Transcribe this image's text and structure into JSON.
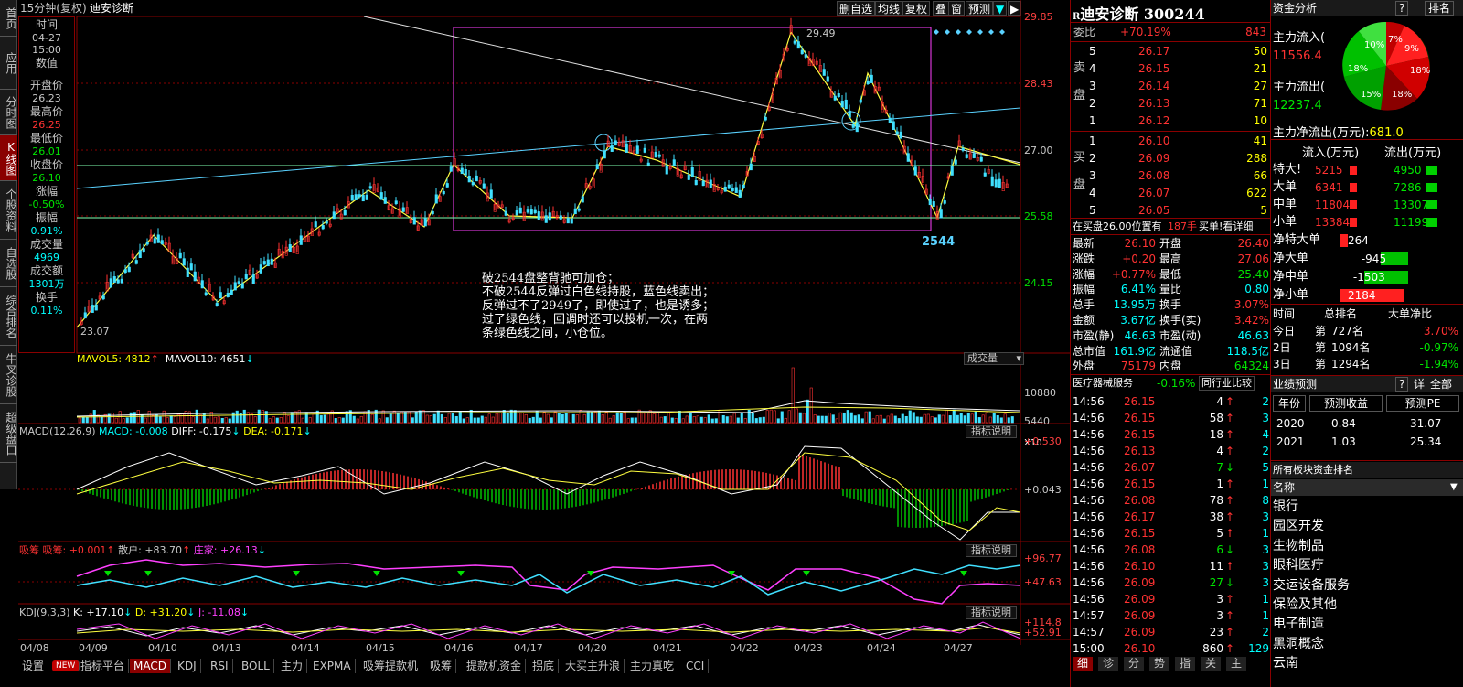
{
  "sidebar": {
    "tabs": [
      "首页",
      "应用",
      "分时图",
      "K线图",
      "个股资料",
      "自选股",
      "综合排名",
      "牛叉诊股",
      "超级盘口"
    ],
    "active": 3
  },
  "chart_header": {
    "period": "15分钟(复权)",
    "name": "迪安诊断",
    "buttons": [
      "删自选",
      "均线",
      "复权",
      "叠",
      "窗",
      "预测"
    ],
    "arrow_icons": [
      "down-arrow-icon",
      "right-arrow-icon"
    ]
  },
  "info": {
    "time_label": "时间",
    "time_date": "04-27",
    "time_clock": "15:00",
    "value_label": "数值",
    "open_label": "开盘价",
    "open": "26.23",
    "high_label": "最高价",
    "high": "26.25",
    "low_label": "最低价",
    "low": "26.01",
    "close_label": "收盘价",
    "close": "26.10",
    "chg_label": "涨幅",
    "chg": "-0.50%",
    "amp_label": "振幅",
    "amp": "0.91%",
    "vol_label": "成交量",
    "vol": "4969",
    "amt_label": "成交额",
    "amt": "1301万",
    "turn_label": "换手",
    "turn": "0.11%"
  },
  "main_chart": {
    "y_labels": [
      "29.85",
      "28.43",
      "27.00",
      "25.58",
      "24.15"
    ],
    "peak_label": "29.49",
    "low_label": "23.07",
    "box_label": "2544",
    "annotation": [
      "破2544盘整背驰可加仓；",
      "不破2544反弹过白色线持股，蓝色线卖出；",
      "反弹过不了2949了，即使过了，也是诱多；",
      "过了绿色线，回调时还可以投机一次，在两",
      "条绿色线之间，小仓位。"
    ]
  },
  "volume_panel": {
    "mavol5_label": "MAVOL5: ",
    "mavol5": "4812",
    "mavol10_label": "MAVOL10: ",
    "mavol10": "4651",
    "selector": "成交量",
    "y_labels": [
      "10880",
      "5440",
      "X10"
    ]
  },
  "macd_panel": {
    "title": "MACD(12,26,9)",
    "macd": "MACD: -0.008",
    "diff": "DIFF: -0.175",
    "dea": "DEA: -0.171",
    "explain": "指标说明",
    "y_labels": [
      "+0.530",
      "+0.043"
    ]
  },
  "xichou_panel": {
    "title": "吸筹",
    "title2": "吸筹: +0.001",
    "sanhu": "散户: +83.70",
    "zhuangjia": "庄家: +26.13",
    "explain": "指标说明",
    "y_labels": [
      "+96.77",
      "+47.63"
    ]
  },
  "kdj_panel": {
    "title": "KDJ(9,3,3)",
    "k": "K: +17.10",
    "d": "D: +31.20",
    "j": "J: -11.08",
    "explain": "指标说明",
    "y_labels": [
      "+114.8",
      "+52.91"
    ]
  },
  "x_axis": [
    "04/08",
    "04/09",
    "04/10",
    "04/13",
    "04/14",
    "04/15",
    "04/16",
    "04/17",
    "04/20",
    "04/21",
    "04/22",
    "04/23",
    "04/24",
    "04/27"
  ],
  "bottom_tabs": [
    "设置",
    "NEW",
    "指标平台",
    "MACD",
    "KDJ",
    "RSI",
    "BOLL",
    "主力",
    "EXPMA",
    "吸筹提款机",
    "吸筹",
    "提款机资金",
    "拐底",
    "大买主升浪",
    "主力真吃",
    "CCI"
  ],
  "stock": {
    "prefix": "R",
    "name": "迪安诊断",
    "code": "300244",
    "weibi_label": "委比",
    "weibi": "+70.19%",
    "weicha": "843",
    "sell_label": "卖盘",
    "buy_label": "买盘",
    "sells": [
      {
        "n": "5",
        "p": "26.17",
        "v": "50"
      },
      {
        "n": "4",
        "p": "26.15",
        "v": "21"
      },
      {
        "n": "3",
        "p": "26.14",
        "v": "27"
      },
      {
        "n": "2",
        "p": "26.13",
        "v": "71"
      },
      {
        "n": "1",
        "p": "26.12",
        "v": "10"
      }
    ],
    "buys": [
      {
        "n": "1",
        "p": "26.10",
        "v": "41"
      },
      {
        "n": "2",
        "p": "26.09",
        "v": "288"
      },
      {
        "n": "3",
        "p": "26.08",
        "v": "66"
      },
      {
        "n": "4",
        "p": "26.07",
        "v": "622"
      },
      {
        "n": "5",
        "p": "26.05",
        "v": "5"
      }
    ],
    "position_note": "在买盘26.00位置有",
    "position_hands": "187手",
    "buy_one": "买单!看详细"
  },
  "quote": [
    {
      "l1": "最新",
      "v1": "26.10",
      "l2": "开盘",
      "v2": "26.40"
    },
    {
      "l1": "涨跌",
      "v1": "+0.20",
      "l2": "最高",
      "v2": "27.06"
    },
    {
      "l1": "涨幅",
      "v1": "+0.77%",
      "l2": "最低",
      "v2": "25.40"
    },
    {
      "l1": "振幅",
      "v1": "6.41%",
      "l2": "量比",
      "v2": "0.80"
    },
    {
      "l1": "总手",
      "v1": "13.95万",
      "l2": "换手",
      "v2": "3.07%"
    },
    {
      "l1": "金额",
      "v1": "3.67亿",
      "l2": "换手(实)",
      "v2": "3.42%"
    },
    {
      "l1": "市盈(静)",
      "v1": "46.63",
      "l2": "市盈(动)",
      "v2": "46.63"
    },
    {
      "l1": "总市值",
      "v1": "161.9亿",
      "l2": "流通值",
      "v2": "118.5亿"
    },
    {
      "l1": "外盘",
      "v1": "75179",
      "l2": "内盘",
      "v2": "64324"
    }
  ],
  "sector": {
    "name": "医疗器械服务",
    "chg": "-0.16%",
    "compare": "同行业比较"
  },
  "ticks": [
    {
      "t": "14:56",
      "p": "26.15",
      "v": "4",
      "dir": "up",
      "n": "2"
    },
    {
      "t": "14:56",
      "p": "26.15",
      "v": "58",
      "dir": "up",
      "n": "3"
    },
    {
      "t": "14:56",
      "p": "26.15",
      "v": "18",
      "dir": "up",
      "n": "4"
    },
    {
      "t": "14:56",
      "p": "26.13",
      "v": "4",
      "dir": "up",
      "n": "2"
    },
    {
      "t": "14:56",
      "p": "26.07",
      "v": "7",
      "dir": "down",
      "n": "5"
    },
    {
      "t": "14:56",
      "p": "26.15",
      "v": "1",
      "dir": "up",
      "n": "1"
    },
    {
      "t": "14:56",
      "p": "26.08",
      "v": "78",
      "dir": "up",
      "n": "8"
    },
    {
      "t": "14:56",
      "p": "26.17",
      "v": "38",
      "dir": "up",
      "n": "3"
    },
    {
      "t": "14:56",
      "p": "26.15",
      "v": "5",
      "dir": "up",
      "n": "1"
    },
    {
      "t": "14:56",
      "p": "26.08",
      "v": "6",
      "dir": "down",
      "n": "3"
    },
    {
      "t": "14:56",
      "p": "26.10",
      "v": "11",
      "dir": "up",
      "n": "3"
    },
    {
      "t": "14:56",
      "p": "26.09",
      "v": "27",
      "dir": "down",
      "n": "3"
    },
    {
      "t": "14:56",
      "p": "26.09",
      "v": "3",
      "dir": "up",
      "n": "1"
    },
    {
      "t": "14:57",
      "p": "26.09",
      "v": "3",
      "dir": "up",
      "n": "1"
    },
    {
      "t": "14:57",
      "p": "26.09",
      "v": "23",
      "dir": "up",
      "n": "2"
    },
    {
      "t": "15:00",
      "p": "26.10",
      "v": "860",
      "dir": "up",
      "n": "129"
    }
  ],
  "tick_tabs": [
    "细",
    "诊",
    "分",
    "势",
    "指",
    "关",
    "主"
  ],
  "funds": {
    "title": "资金分析",
    "help": "?",
    "rank": "排名",
    "inflow_label": "主力流入(",
    "inflow": "11556.4",
    "outflow_label": "主力流出(",
    "outflow": "12237.4",
    "net_label": "主力净流出(万元):",
    "net": "681.0",
    "pie_labels": [
      "7%",
      "9%",
      "10%",
      "18%",
      "18%",
      "15%",
      "18%"
    ],
    "in_col": "流入(万元)",
    "out_col": "流出(万元)",
    "rows": [
      {
        "l": "特大!",
        "in": "5215",
        "out": "4950"
      },
      {
        "l": "大单",
        "in": "6341",
        "out": "7286"
      },
      {
        "l": "中单",
        "in": "11804",
        "out": "13307"
      },
      {
        "l": "小单",
        "in": "13384",
        "out": "11199"
      }
    ],
    "net_rows": [
      {
        "l": "净特大单",
        "v": "264",
        "sign": "pos"
      },
      {
        "l": "净大单",
        "v": "-945",
        "sign": "neg"
      },
      {
        "l": "净中单",
        "v": "-1503",
        "sign": "neg"
      },
      {
        "l": "净小单",
        "v": "2184",
        "sign": "pos"
      }
    ],
    "rank_header": {
      "a": "时间",
      "b": "总排名",
      "c": "大单净比"
    },
    "rank_rows": [
      {
        "a": "今日",
        "b": "第",
        "c": "727名",
        "d": "3.70%",
        "dsign": "pos"
      },
      {
        "a": "2日",
        "b": "第",
        "c": "1094名",
        "d": "-0.97%",
        "dsign": "neg"
      },
      {
        "a": "3日",
        "b": "第",
        "c": "1294名",
        "d": "-1.94%",
        "dsign": "neg"
      }
    ]
  },
  "forecast": {
    "title": "业绩预测",
    "help": "?",
    "detail": "详",
    "all": "全部",
    "cols": [
      "年份",
      "预测收益",
      "预测PE"
    ],
    "rows": [
      {
        "y": "2020",
        "e": "0.84",
        "pe": "31.07"
      },
      {
        "y": "2021",
        "e": "1.03",
        "pe": "25.34"
      }
    ]
  },
  "sector_rank": {
    "title": "所有板块资金排名",
    "header": "名称",
    "items": [
      "银行",
      "园区开发",
      "生物制品",
      "眼科医疗",
      "交运设备服务",
      "保险及其他",
      "电子制造",
      "黑洞概念",
      "云南"
    ]
  }
}
